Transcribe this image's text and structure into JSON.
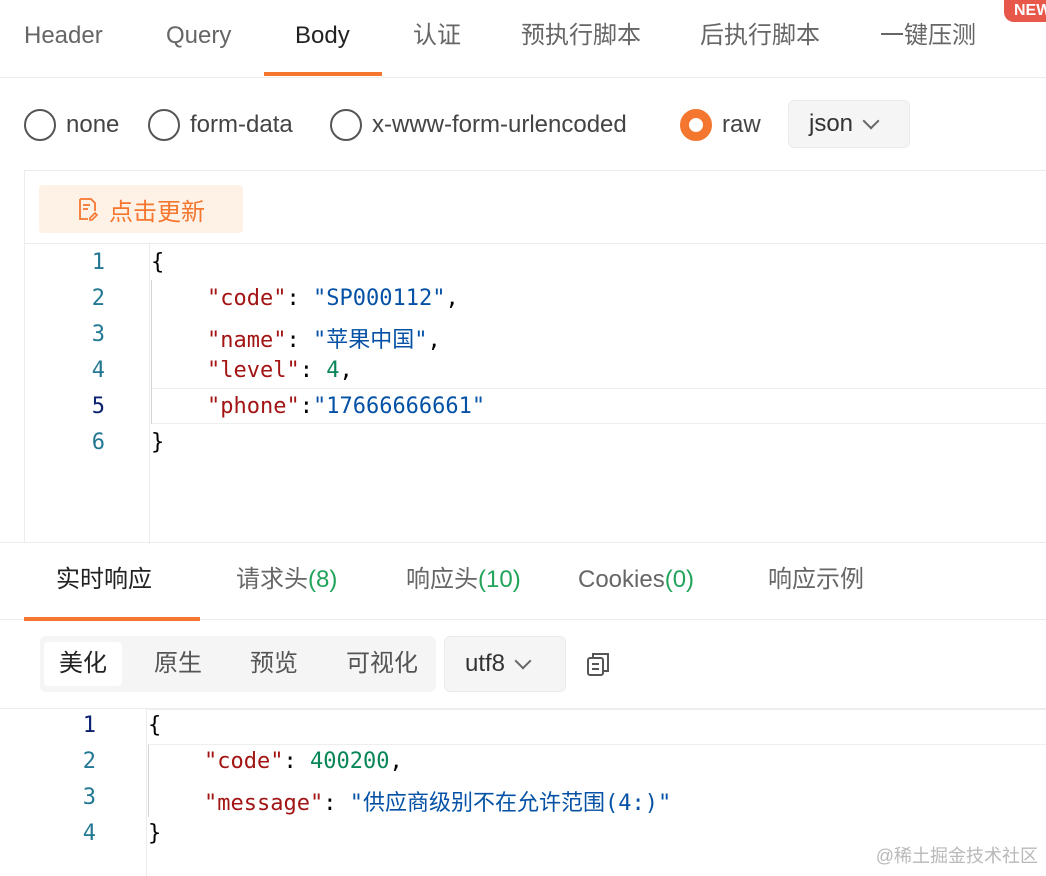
{
  "top_tabs": [
    {
      "label": "Header"
    },
    {
      "label": "Query"
    },
    {
      "label": "Body"
    },
    {
      "label": "认证"
    },
    {
      "label": "预执行脚本"
    },
    {
      "label": "后执行脚本"
    },
    {
      "label": "一键压测"
    }
  ],
  "top_tabs_active": "Body",
  "new_badge": "NEW",
  "body_types": [
    {
      "label": "none",
      "checked": false
    },
    {
      "label": "form-data",
      "checked": false
    },
    {
      "label": "x-www-form-urlencoded",
      "checked": false
    },
    {
      "label": "raw",
      "checked": true
    }
  ],
  "raw_format": "json",
  "update_button": "点击更新",
  "request_line_numbers": [
    "1",
    "2",
    "3",
    "4",
    "5",
    "6"
  ],
  "request_code": {
    "open": "{",
    "code_key": "\"code\"",
    "code_val": "\"SP000112\"",
    "name_key": "\"name\"",
    "name_val": "\"苹果中国\"",
    "level_key": "\"level\"",
    "level_val": "4",
    "phone_key": "\"phone\"",
    "phone_val": "\"17666666661\"",
    "close": "}"
  },
  "response_tabs": {
    "realtime": "实时响应",
    "req_headers": "请求头",
    "req_headers_count": "(8)",
    "resp_headers": "响应头",
    "resp_headers_count": "(10)",
    "cookies": "Cookies",
    "cookies_count": "(0)",
    "examples": "响应示例"
  },
  "view_modes": [
    "美化",
    "原生",
    "预览",
    "可视化"
  ],
  "view_mode_active": "美化",
  "encoding": "utf8",
  "response_line_numbers": [
    "1",
    "2",
    "3",
    "4"
  ],
  "response_code": {
    "open": "{",
    "code_key": "\"code\"",
    "code_val": "400200",
    "message_key": "\"message\"",
    "message_val": "\"供应商级别不在允许范围(4:)\"",
    "close": "}"
  },
  "watermark": "@稀土掘金技术社区",
  "colors": {
    "accent": "#f5772f",
    "count_green": "#22a35a",
    "json_key": "#a31515",
    "json_string": "#0451a5",
    "json_number": "#098658",
    "line_number": "#237893"
  }
}
